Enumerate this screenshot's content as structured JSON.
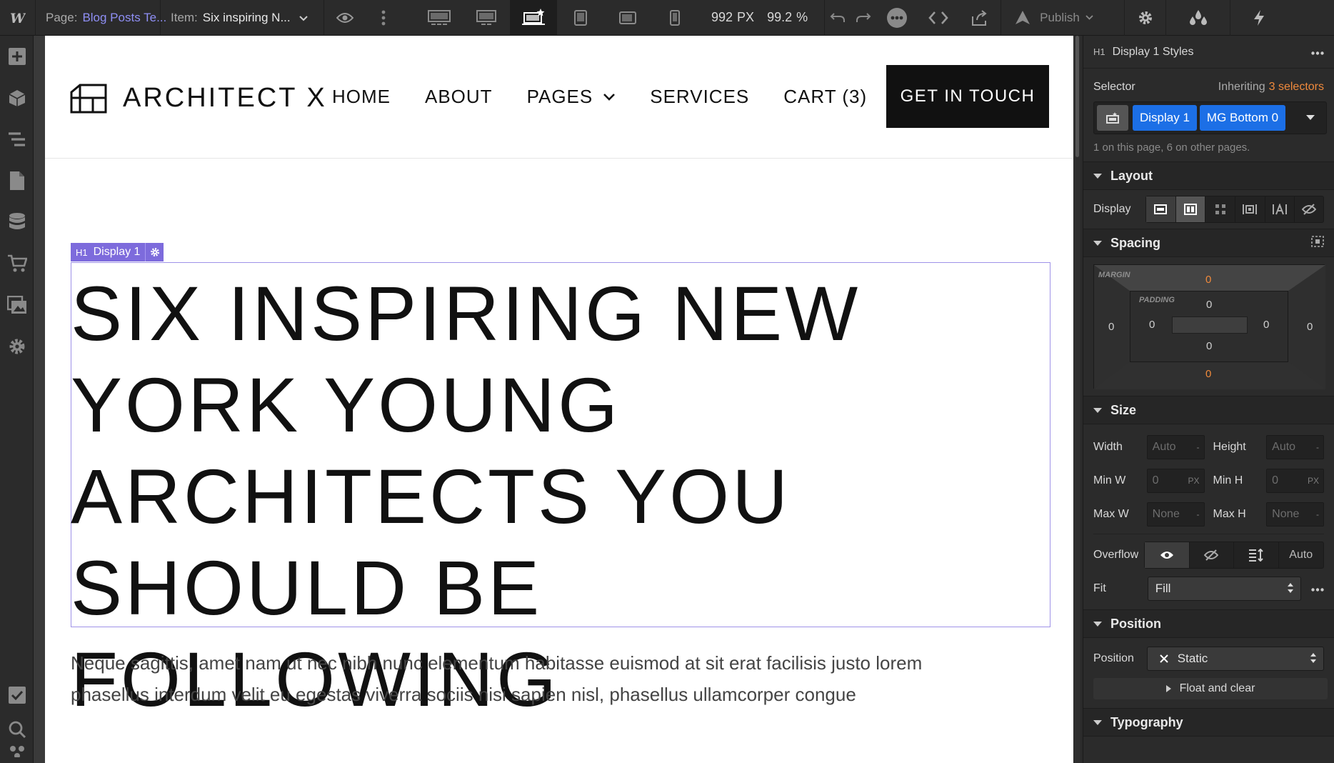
{
  "topbar": {
    "page_label": "Page:",
    "page_value": "Blog Posts Te...",
    "item_label": "Item:",
    "item_value": "Six inspiring N...",
    "width_value": "992",
    "width_unit": "PX",
    "zoom_value": "99.2",
    "zoom_unit": "%",
    "publish_label": "Publish"
  },
  "site": {
    "brand": "ARCHITECT X",
    "nav": {
      "home": "HOME",
      "about": "ABOUT",
      "pages": "PAGES",
      "services": "SERVICES",
      "cart": "CART (3)"
    },
    "cta": "GET IN TOUCH",
    "selected_tag": "H1",
    "selected_name": "Display 1",
    "headline": "SIX INSPIRING NEW YORK YOUNG ARCHITECTS YOU SHOULD BE FOLLOWING",
    "paragraph": "Neque sagittis, amet nam ut nec nibh nunc elementum habitasse euismod at sit erat facilisis justo lorem phasellus interdum velit eu egestas viverra sociis nisi sapien nisl, phasellus ullamcorper congue"
  },
  "panel": {
    "header_tag": "H1",
    "header_title": "Display 1 Styles",
    "selector_label": "Selector",
    "inheriting_text": "Inheriting",
    "inheriting_count": "3 selectors",
    "chips": [
      "Display 1",
      "MG Bottom 0"
    ],
    "usage_note": "1 on this page, 6 on other pages.",
    "sections": {
      "layout": "Layout",
      "spacing": "Spacing",
      "size": "Size",
      "position": "Position",
      "typography": "Typography"
    },
    "display_label": "Display",
    "spacing": {
      "margin_label": "MARGIN",
      "padding_label": "PADDING",
      "margin_top": "0",
      "margin_bottom": "0",
      "margin_left": "0",
      "margin_right": "0",
      "padding_top": "0",
      "padding_bottom": "0",
      "padding_left": "0",
      "padding_right": "0"
    },
    "size": {
      "width_label": "Width",
      "width_value": "Auto",
      "height_label": "Height",
      "height_value": "Auto",
      "minw_label": "Min W",
      "minw_value": "0",
      "minh_label": "Min H",
      "minh_value": "0",
      "maxw_label": "Max W",
      "maxw_value": "None",
      "maxh_label": "Max H",
      "maxh_value": "None",
      "dash": "-",
      "px_unit": "PX",
      "overflow_label": "Overflow",
      "overflow_auto": "Auto",
      "fit_label": "Fit",
      "fit_value": "Fill"
    },
    "position": {
      "position_label": "Position",
      "position_value": "Static",
      "float_clear": "Float and clear"
    }
  },
  "colors": {
    "accent_blue": "#1c6fe6",
    "link_purple": "#8f8ff5",
    "selection_purple": "#7d6bdc",
    "orange_value": "#f08a3c"
  }
}
